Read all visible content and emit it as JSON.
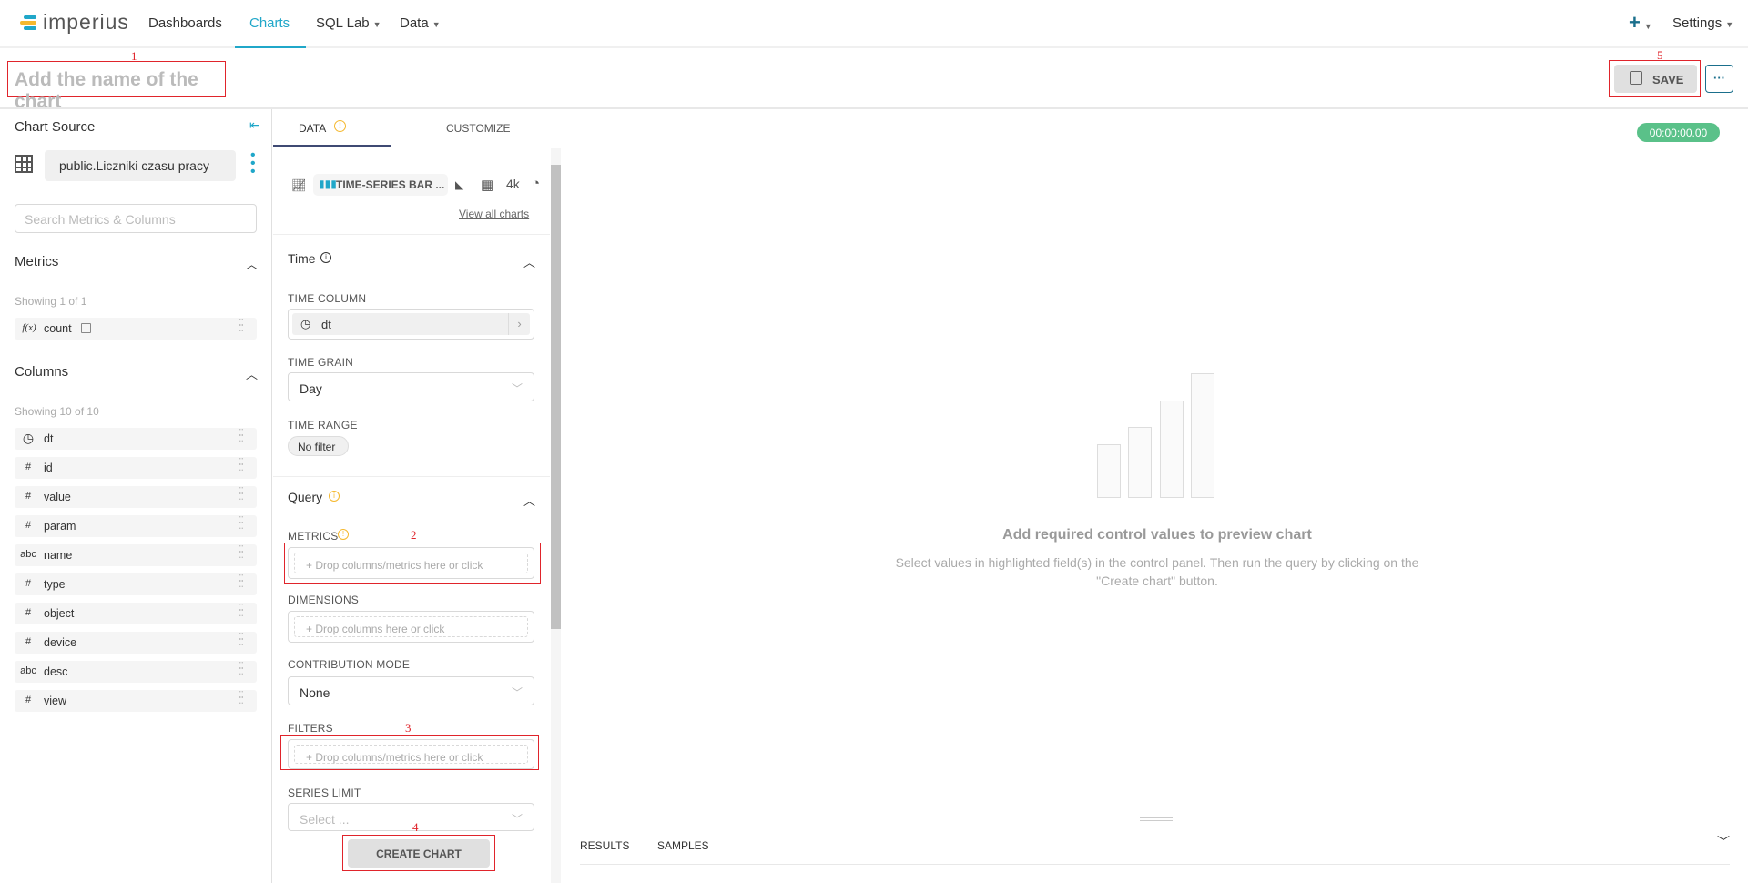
{
  "nav": {
    "brand": "imperius",
    "items": [
      {
        "label": "Dashboards"
      },
      {
        "label": "Charts",
        "active": true
      },
      {
        "label": "SQL Lab"
      },
      {
        "label": "Data"
      }
    ],
    "plus": "+",
    "settings": "Settings"
  },
  "header": {
    "title_placeholder": "Add the name of the chart",
    "save": "SAVE",
    "more": "···",
    "annotations": {
      "title": "1",
      "save": "5"
    }
  },
  "source": {
    "title": "Chart Source",
    "dataset": "public.Liczniki czasu pracy",
    "search_placeholder": "Search Metrics & Columns",
    "metrics": {
      "title": "Metrics",
      "showing": "Showing 1 of 1",
      "items": [
        {
          "type": "f(x)",
          "name": "count"
        }
      ]
    },
    "columns": {
      "title": "Columns",
      "showing": "Showing 10 of 10",
      "items": [
        {
          "type": "clock",
          "name": "dt"
        },
        {
          "type": "#",
          "name": "id"
        },
        {
          "type": "#",
          "name": "value"
        },
        {
          "type": "#",
          "name": "param"
        },
        {
          "type": "abc",
          "name": "name"
        },
        {
          "type": "#",
          "name": "type"
        },
        {
          "type": "#",
          "name": "object"
        },
        {
          "type": "#",
          "name": "device"
        },
        {
          "type": "abc",
          "name": "desc"
        },
        {
          "type": "#",
          "name": "view"
        }
      ]
    }
  },
  "control": {
    "tabs": [
      {
        "label": "DATA",
        "active": true
      },
      {
        "label": "CUSTOMIZE"
      }
    ],
    "chart_type": "TIME-SERIES BAR ...",
    "bignum": "4k",
    "view_all": "View all charts",
    "time": {
      "title": "Time",
      "time_column_label": "TIME COLUMN",
      "time_column": "dt",
      "time_grain_label": "TIME GRAIN",
      "time_grain": "Day",
      "time_range_label": "TIME RANGE",
      "time_range": "No filter"
    },
    "query": {
      "title": "Query",
      "metrics_label": "METRICS",
      "metrics_drop": "Drop columns/metrics here or click",
      "dimensions_label": "DIMENSIONS",
      "dimensions_drop": "Drop columns here or click",
      "contribution_label": "CONTRIBUTION MODE",
      "contribution": "None",
      "filters_label": "FILTERS",
      "filters_drop": "Drop columns/metrics here or click",
      "series_limit_label": "SERIES LIMIT",
      "series_limit_placeholder": "Select ..."
    },
    "create": "CREATE CHART",
    "annotations": {
      "metrics": "2",
      "filters": "3",
      "create": "4"
    }
  },
  "preview": {
    "timer": "00:00:00.00",
    "empty_title": "Add required control values to preview chart",
    "empty_desc": "Select values in highlighted field(s) in the control panel. Then run the query by clicking on the \"Create chart\" button.",
    "tabs": [
      "RESULTS",
      "SAMPLES"
    ]
  },
  "colors": {
    "accent": "#20a7c9",
    "timer": "#5ac189",
    "annotation": "#e0242b"
  }
}
